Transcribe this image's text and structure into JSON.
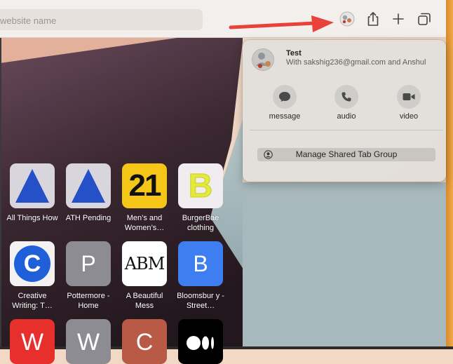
{
  "toolbar": {
    "address_placeholder": "website name"
  },
  "popover": {
    "group_title": "Test",
    "group_subtitle": "With sakshig236@gmail.com and Anshul",
    "actions": [
      {
        "label": "message",
        "icon": "message-bubble-icon"
      },
      {
        "label": "audio",
        "icon": "phone-icon"
      },
      {
        "label": "video",
        "icon": "video-camera-icon"
      }
    ],
    "manage_label": "Manage Shared Tab Group"
  },
  "favorites": [
    {
      "label": "All Things How",
      "tile": "blue-triangle"
    },
    {
      "label": "ATH Pending",
      "tile": "blue-triangle"
    },
    {
      "label": "Men’s and Women’s…",
      "tile": "21"
    },
    {
      "label": "BurgerBae clothing",
      "tile": "B"
    },
    {
      "label": "Creative Writing: T…",
      "tile": "C"
    },
    {
      "label": "Pottermore - Home",
      "tile": "P"
    },
    {
      "label": "A Beautiful Mess",
      "tile": "ABM"
    },
    {
      "label": "Bloomsbur y - Street…",
      "tile": "B"
    },
    {
      "label": "",
      "tile": "W"
    },
    {
      "label": "",
      "tile": "W"
    },
    {
      "label": "",
      "tile": "C"
    },
    {
      "label": "",
      "tile": "medium"
    }
  ],
  "tiles": {
    "t21": "21",
    "tB1": "B",
    "tC": "C",
    "tP": "P",
    "tABM": "ABM",
    "tB2": "B",
    "tW1": "W",
    "tW2": "W",
    "tC2": "C"
  },
  "colors": {
    "arrow": "#e8423a",
    "bloomsbury_blue": "#3f7ef0",
    "creative_blue": "#1f5fd8"
  }
}
